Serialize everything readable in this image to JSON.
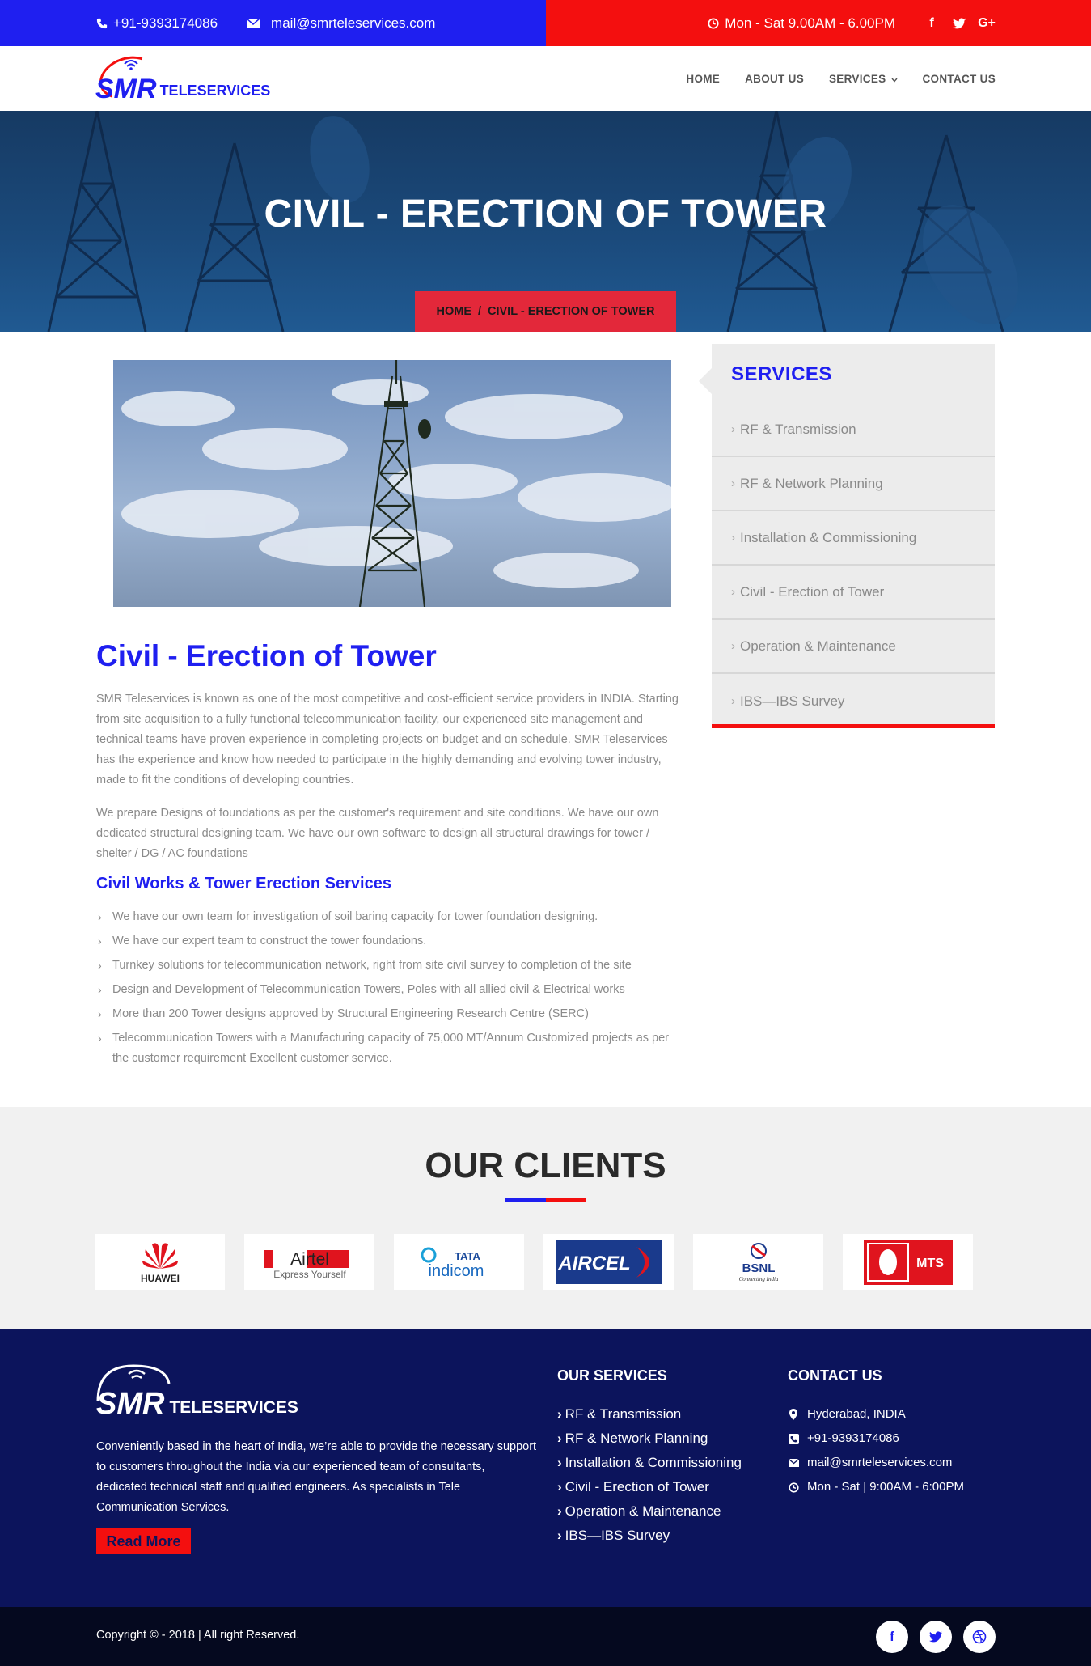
{
  "topbar": {
    "phone": "+91-9393174086",
    "email": "mail@smrteleservices.com",
    "hours": "Mon - Sat 9.00AM - 6.00PM",
    "social": [
      "f",
      "t",
      "G+"
    ],
    "left_color": "#1f1ff0",
    "right_color": "#f40f0f"
  },
  "brand": {
    "logo_mark": "SMR",
    "logo_text": "TELESERVICES"
  },
  "nav": {
    "items": [
      {
        "label": "HOME"
      },
      {
        "label": "ABOUT US"
      },
      {
        "label": "SERVICES"
      },
      {
        "label": "CONTACT US"
      }
    ]
  },
  "hero": {
    "title": "CIVIL - ERECTION OF TOWER",
    "breadcrumb_home": "HOME",
    "breadcrumb_sep": "/",
    "breadcrumb_current": "CIVIL - ERECTION OF TOWER"
  },
  "content": {
    "title": "Civil - Erection of Tower",
    "paragraph1": "SMR Teleservices is known as one of the most competitive and cost-efficient service providers in INDIA. Starting from site acquisition to a fully functional telecommunication facility, our experienced site management and technical teams have proven experience in completing projects on budget and on schedule. SMR Teleservices has the experience and know how needed to participate in the highly demanding and evolving tower industry, made to fit the conditions of developing countries.",
    "paragraph2": "We prepare Designs of foundations as per the customer's requirement and site conditions. We have our own dedicated structural designing team. We have our own software to design all structural drawings for tower / shelter / DG / AC foundations",
    "subtitle": "Civil Works & Tower Erection Services",
    "bullets": [
      "We have our own team for investigation of soil baring capacity for tower foundation designing.",
      "We have our expert team to construct the tower foundations.",
      "Turnkey solutions for telecommunication network, right from site civil survey to completion of the site",
      "Design and Development of Telecommunication Towers, Poles with all allied civil & Electrical works",
      "More than 200 Tower designs approved by Structural Engineering Research Centre (SERC)",
      "Telecommunication Towers with a Manufacturing capacity of 75,000 MT/Annum Customized projects as per the customer requirement Excellent customer service."
    ]
  },
  "sidebar": {
    "title": "SERVICES",
    "items": [
      "RF & Transmission",
      "RF & Network Planning",
      "Installation & Commissioning",
      "Civil - Erection of Tower",
      "Operation & Maintenance",
      "IBS—IBS Survey"
    ]
  },
  "clients": {
    "title": "OUR CLIENTS",
    "logos": [
      {
        "name": "HUAWEI"
      },
      {
        "name": "Airtel",
        "tagline": "Express Yourself"
      },
      {
        "name": "TATA indicom",
        "brand": "TATA",
        "sub": "indicom"
      },
      {
        "name": "AIRCEL"
      },
      {
        "name": "BSNL",
        "tagline": "Connecting India"
      },
      {
        "name": "MTS"
      }
    ]
  },
  "footer": {
    "logo_mark": "SMR",
    "logo_text": "TELESERVICES",
    "about": "Conveniently based in the heart of India, we’re able to provide the necessary support to customers throughout the India via our experienced team of consultants, dedicated technical staff and qualified engineers. As specialists in Tele Communication Services.",
    "read_more": "Read More",
    "services_title": "OUR SERVICES",
    "services": [
      "RF & Transmission",
      "RF & Network Planning",
      "Installation & Commissioning",
      "Civil - Erection of Tower",
      "Operation & Maintenance",
      "IBS—IBS Survey"
    ],
    "contact_title": "CONTACT US",
    "contact": [
      {
        "icon": "map-marker-icon",
        "text": "Hyderabad, INDIA"
      },
      {
        "icon": "phone-icon",
        "text": "+91-9393174086"
      },
      {
        "icon": "envelope-icon",
        "text": "mail@smrteleservices.com"
      },
      {
        "icon": "clock-icon",
        "text": "Mon - Sat | 9:00AM - 6:00PM"
      }
    ],
    "copyright": "Copyright © - 2018 | All right Reserved."
  }
}
